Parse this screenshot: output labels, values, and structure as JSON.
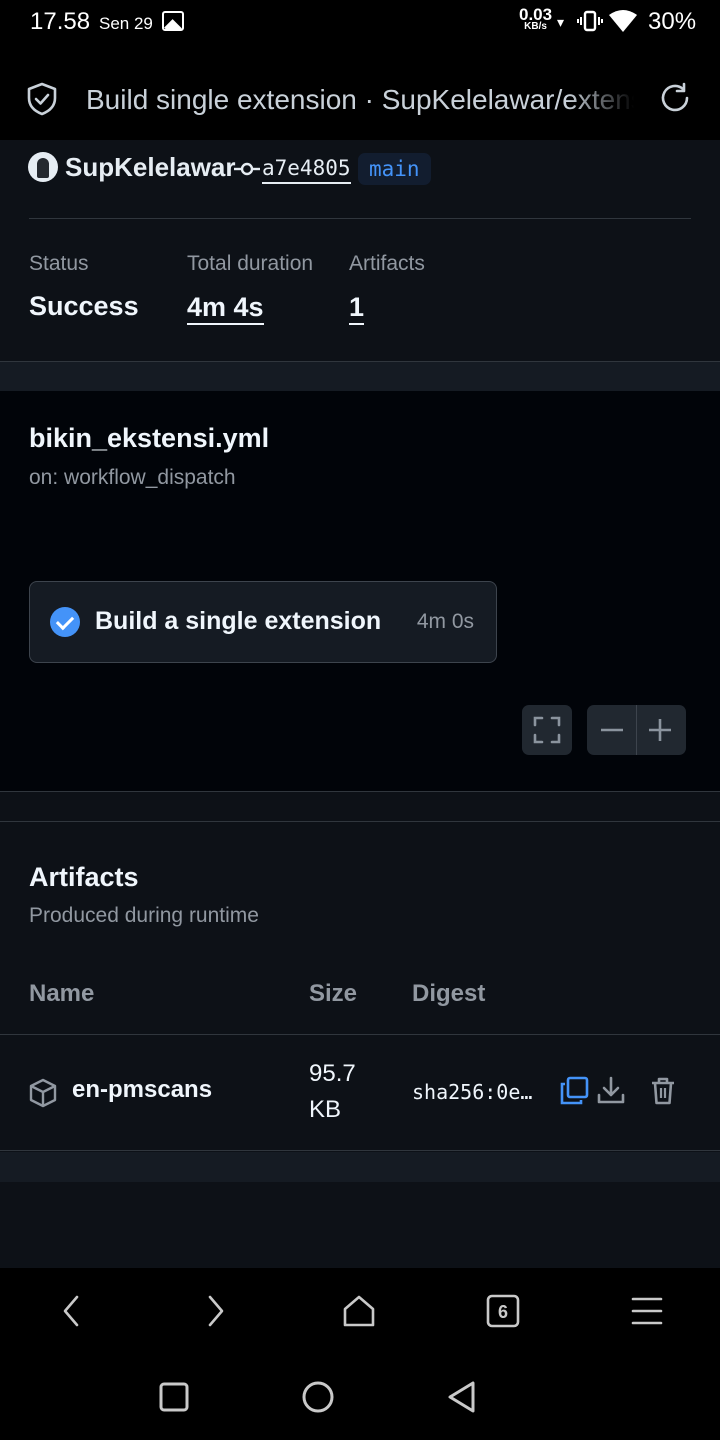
{
  "status_bar": {
    "time": "17.58",
    "date": "Sen 29",
    "net_speed": "0.03",
    "net_speed_unit": "KB/s",
    "battery": "30%"
  },
  "top_bar": {
    "title": "Build single extension · SupKelelawar/extensions-source",
    "icons": [
      "shield-check-icon",
      "refresh-icon"
    ]
  },
  "run_summary": {
    "author": "SupKelelawar",
    "commit_sha": "a7e4805",
    "branch": "main",
    "status_label": "Status",
    "status_value": "Success",
    "duration_label": "Total duration",
    "duration_value": "4m 4s",
    "artifacts_label": "Artifacts",
    "artifacts_value": "1"
  },
  "workflow": {
    "file": "bikin_ekstensi.yml",
    "trigger": "on: workflow_dispatch",
    "job": {
      "name": "Build a single extension",
      "duration": "4m 0s",
      "status": "success"
    },
    "controls": [
      "fullscreen-icon",
      "zoom-out-icon",
      "zoom-in-icon"
    ]
  },
  "artifacts": {
    "title": "Artifacts",
    "subtitle": "Produced during runtime",
    "columns": [
      "Name",
      "Size",
      "Digest"
    ],
    "rows": [
      {
        "name": "en-pmscans",
        "size": "95.7 KB",
        "digest": "sha256:0e…"
      }
    ]
  },
  "browser_toolbar": {
    "tab_count": "6",
    "icons": [
      "back-icon",
      "forward-icon",
      "home-icon",
      "tabs-icon",
      "menu-icon"
    ]
  },
  "colors": {
    "accent": "#4493f8",
    "background": "#0d1117",
    "graph_background": "#010409",
    "muted_text": "#9198a1"
  }
}
